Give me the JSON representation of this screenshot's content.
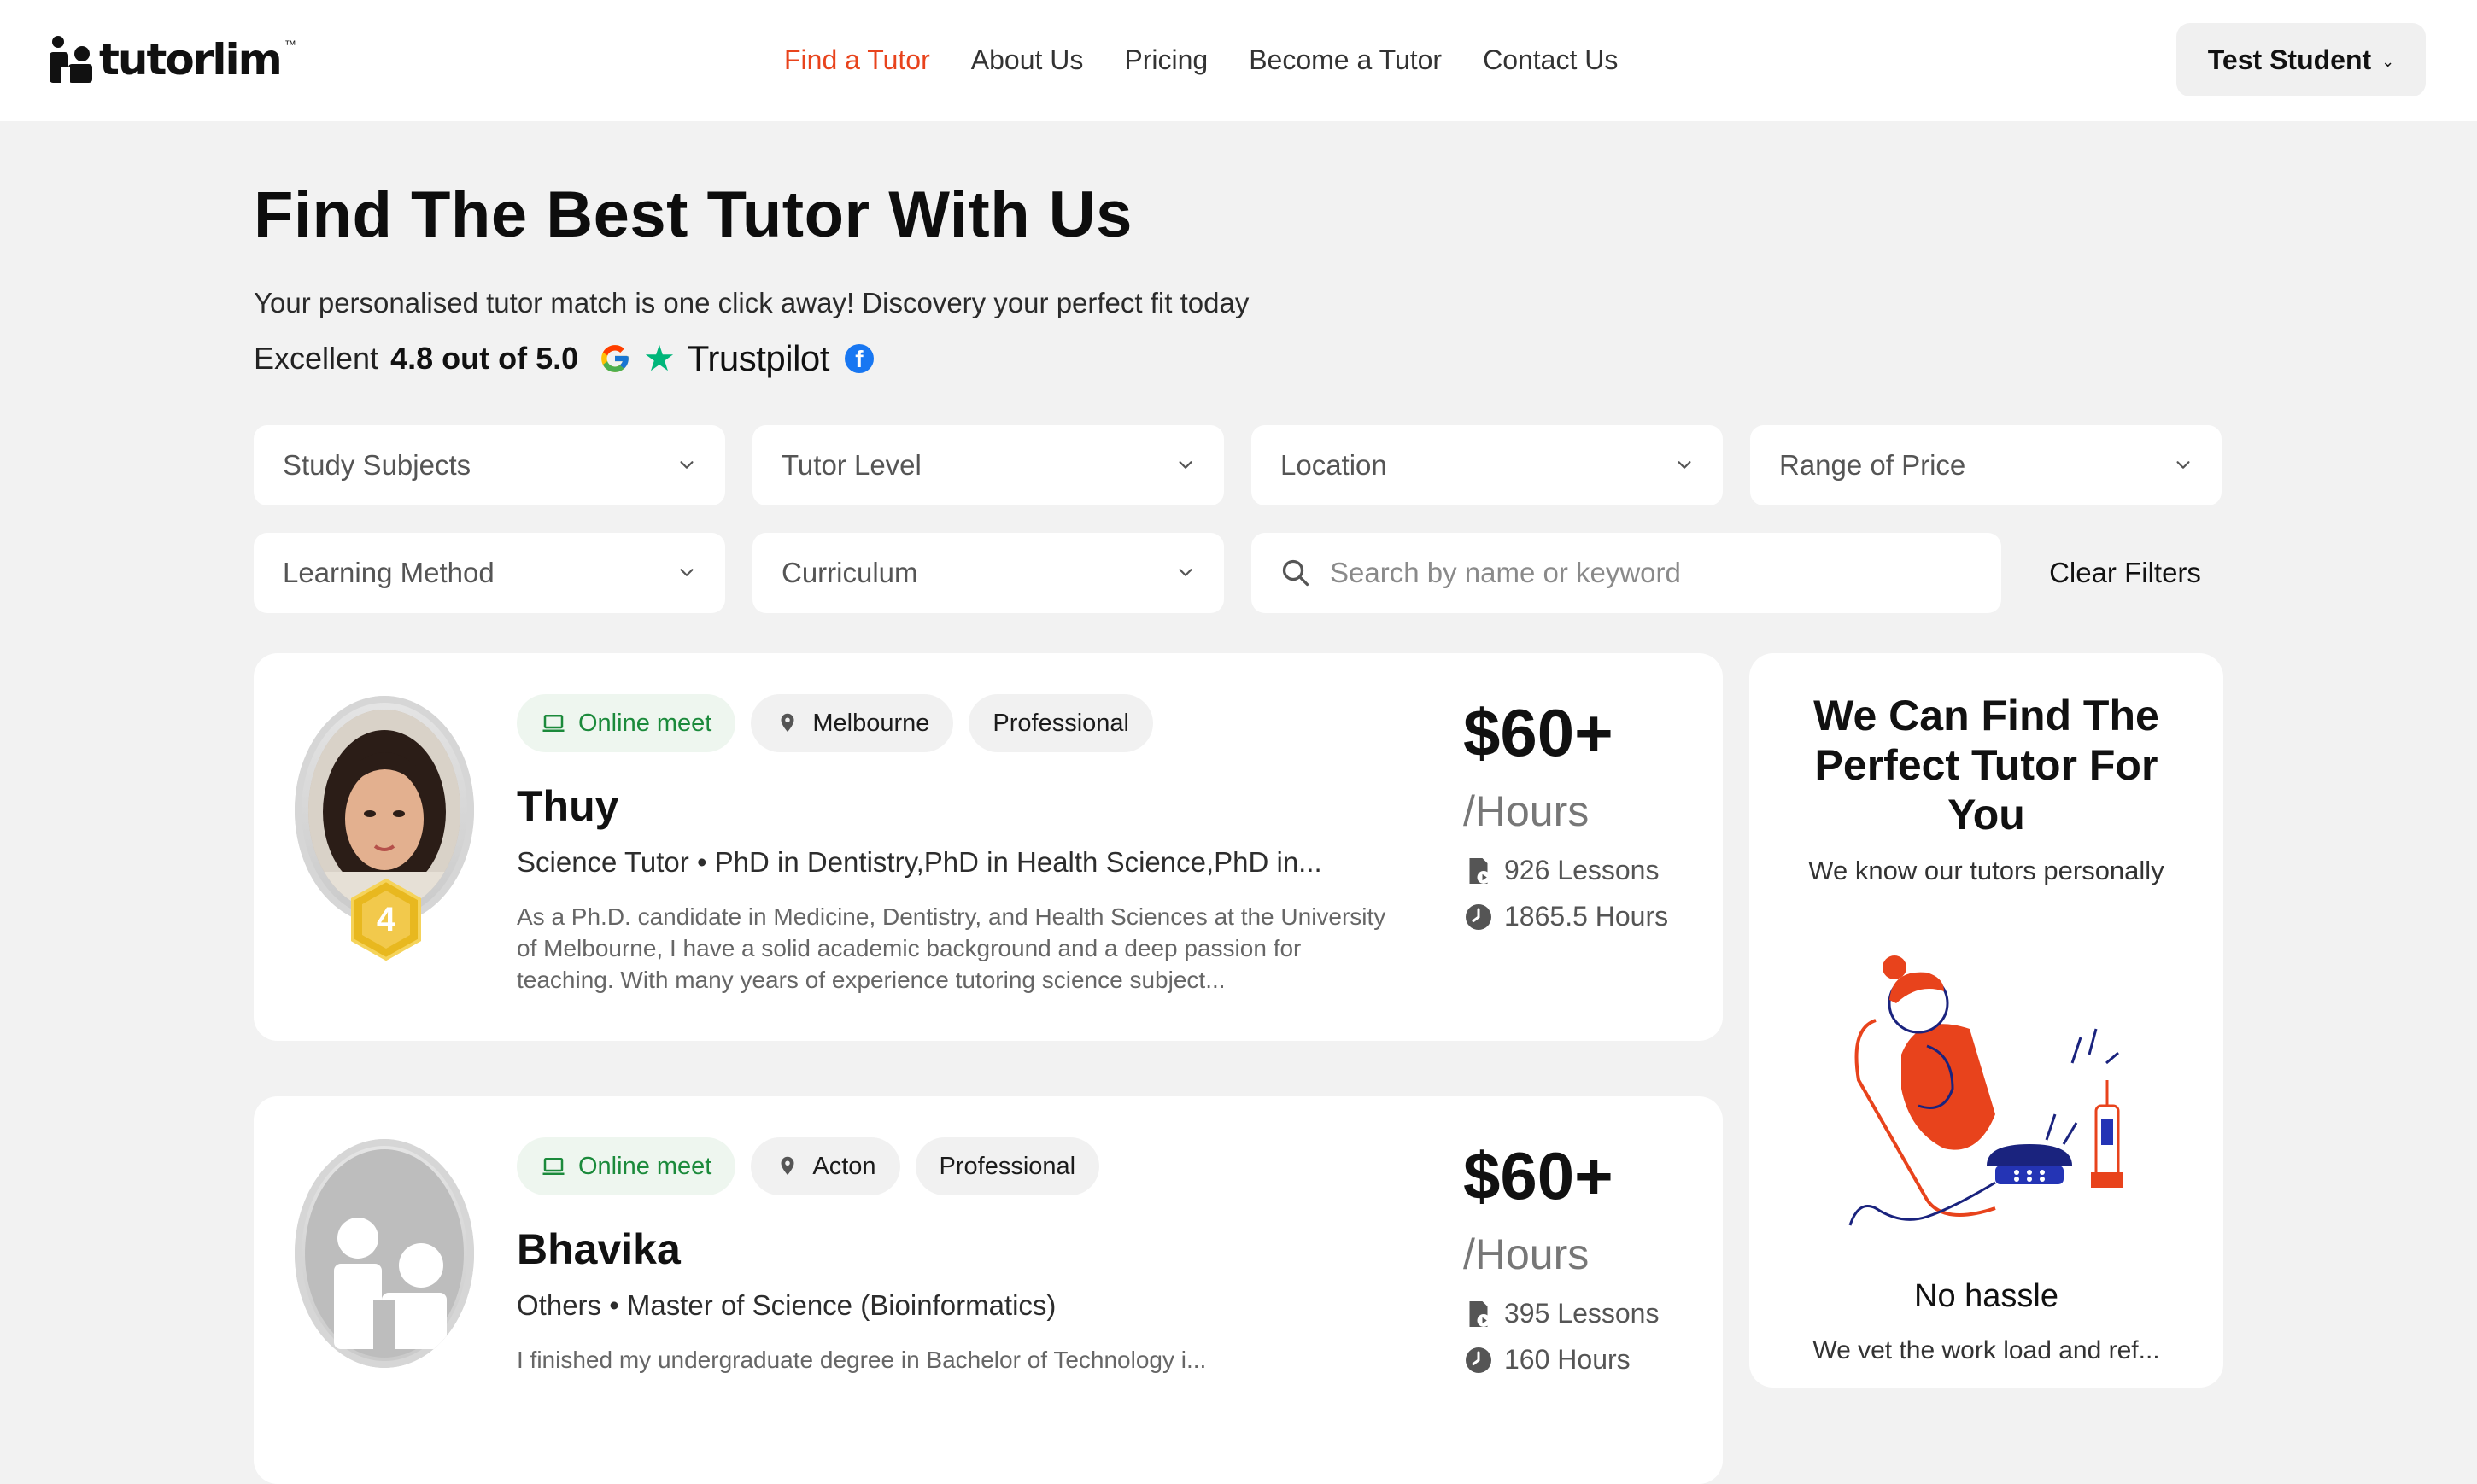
{
  "header": {
    "logo_text": "tutorlim",
    "logo_tm": "™",
    "nav": [
      {
        "label": "Find a Tutor",
        "active": true
      },
      {
        "label": "About Us"
      },
      {
        "label": "Pricing"
      },
      {
        "label": "Become a Tutor"
      },
      {
        "label": "Contact Us"
      }
    ],
    "user_label": "Test Student",
    "user_chevron": "⌄"
  },
  "hero": {
    "title": "Find The Best Tutor With Us",
    "subtitle": "Your personalised tutor match is one click away! Discovery your perfect fit today",
    "rating_prefix": "Excellent",
    "rating_value": "4.8 out of 5.0",
    "trustpilot": "Trustpilot"
  },
  "filters": {
    "study_subjects": "Study Subjects",
    "tutor_level": "Tutor Level",
    "location": "Location",
    "range_of_price": "Range of Price",
    "learning_method": "Learning Method",
    "curriculum": "Curriculum",
    "search_placeholder": "Search by name or keyword",
    "clear_label": "Clear Filters"
  },
  "tutors": [
    {
      "tags": [
        "Online meet",
        "Melbourne",
        "Professional"
      ],
      "name": "Thuy",
      "qualification": "Science Tutor • PhD in Dentistry,PhD in Health Science,PhD in...",
      "bio": "As a Ph.D. candidate in Medicine, Dentistry, and Health Sciences at the University of Melbourne, I have a solid academic background and a deep passion for teaching. With many years of experience tutoring science subject...",
      "price": "$60+",
      "per": "/Hours",
      "lessons": "926 Lessons",
      "hours": "1865.5 Hours",
      "level": "4"
    },
    {
      "tags": [
        "Online meet",
        "Acton",
        "Professional"
      ],
      "name": "Bhavika",
      "qualification": "Others • Master of Science (Bioinformatics)",
      "bio": "I finished my undergraduate degree in Bachelor of Technology i...",
      "price": "$60+",
      "per": "/Hours",
      "lessons": "395 Lessons",
      "hours": "160 Hours"
    }
  ],
  "promo": {
    "title": "We Can Find The Perfect Tutor For You",
    "subtitle": "We know our tutors personally",
    "footer": "No hassle",
    "footer_sub": "We vet the work load and ref..."
  },
  "colors": {
    "accent": "#e8431c",
    "online_tag": "#1b8a3b",
    "trustpilot_star": "#00b67a",
    "facebook": "#1877f2"
  }
}
